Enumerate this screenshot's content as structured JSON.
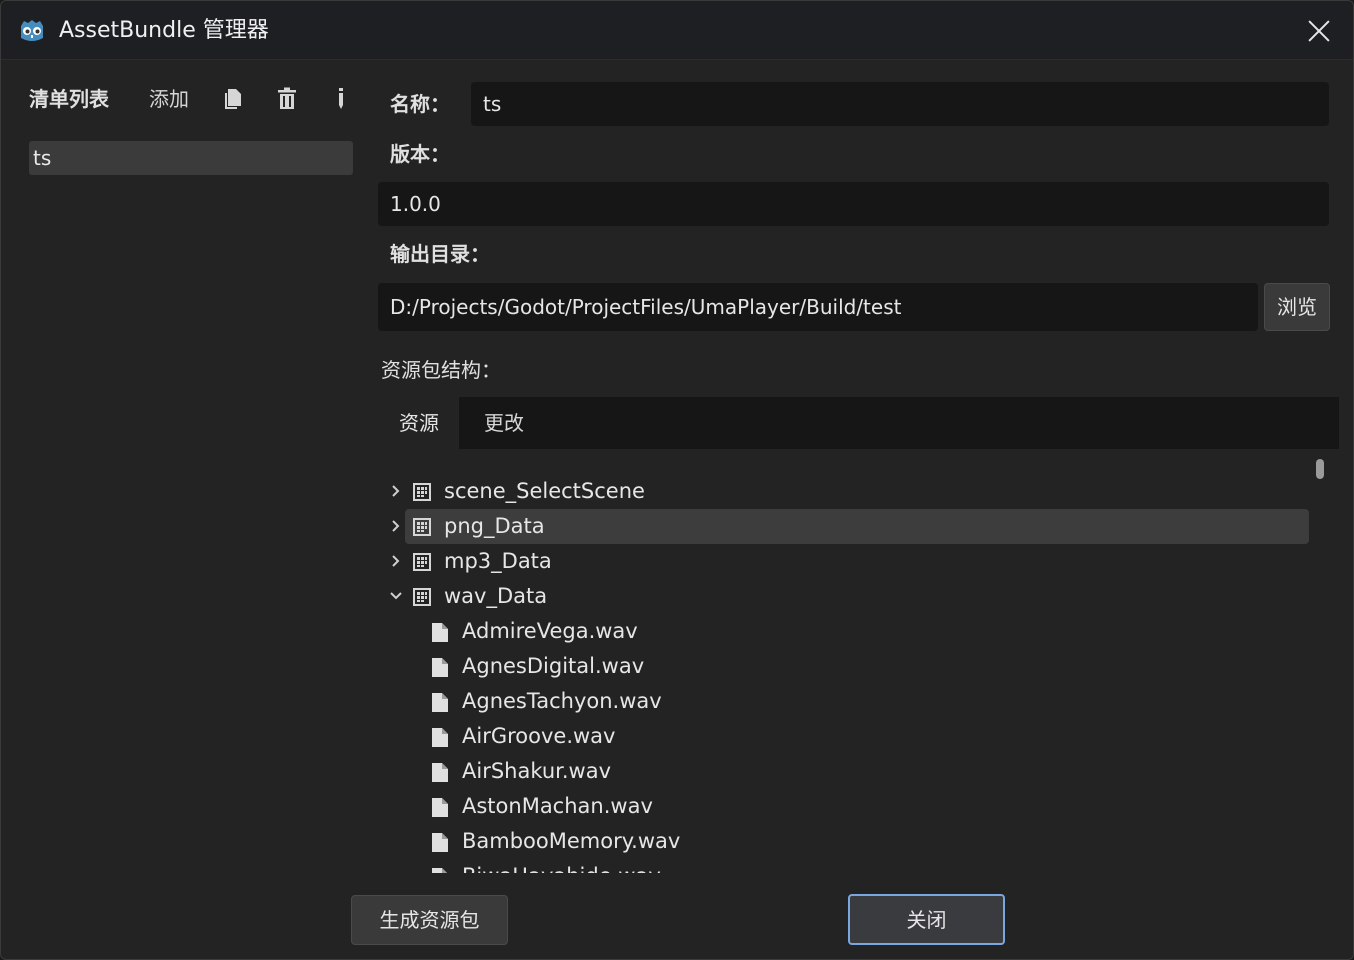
{
  "window": {
    "title": "AssetBundle 管理器"
  },
  "sidebar": {
    "heading": "清单列表",
    "add_label": "添加",
    "items": [
      "ts"
    ]
  },
  "form": {
    "name_label": "名称：",
    "name_value": "ts",
    "version_label": "版本：",
    "version_value": "1.0.0",
    "output_label": "输出目录：",
    "output_value": "D:/Projects/Godot/ProjectFiles/UmaPlayer/Build/test",
    "browse_label": "浏览",
    "structure_label": "资源包结构："
  },
  "tabs": [
    "资源",
    "更改"
  ],
  "tree": {
    "groups": [
      {
        "label": "scene_SelectScene",
        "expanded": false
      },
      {
        "label": "png_Data",
        "expanded": false,
        "selected": true
      },
      {
        "label": "mp3_Data",
        "expanded": false
      },
      {
        "label": "wav_Data",
        "expanded": true
      }
    ],
    "files": [
      "AdmireVega.wav",
      "AgnesDigital.wav",
      "AgnesTachyon.wav",
      "AirGroove.wav",
      "AirShakur.wav",
      "AstonMachan.wav",
      "BambooMemory.wav",
      "BiwaHayahide.wav"
    ]
  },
  "footer": {
    "build_label": "生成资源包",
    "close_label": "关闭"
  },
  "colors": {
    "accent_border": "#7aa7e0",
    "window_bg": "#232323",
    "field_bg": "#161616"
  }
}
